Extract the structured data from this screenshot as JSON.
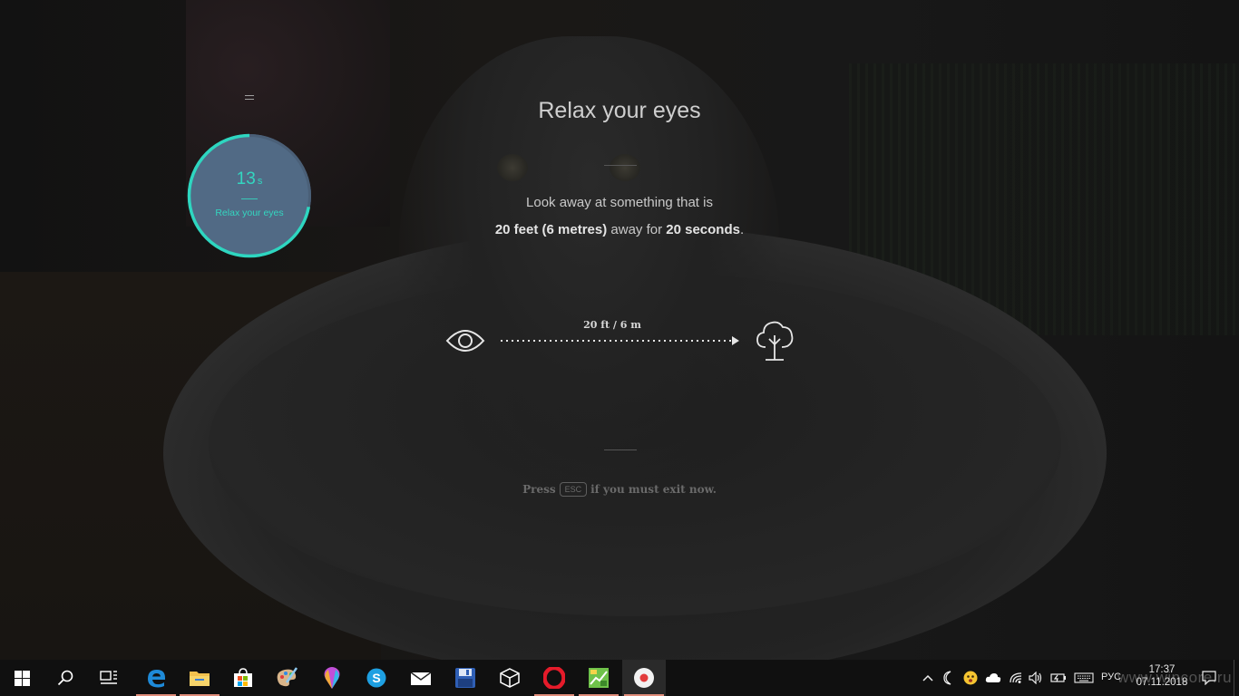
{
  "timer": {
    "seconds": "13",
    "unit": "s",
    "label": "Relax your eyes",
    "progress": 0.72,
    "accent": "#2ed6c0"
  },
  "main": {
    "title": "Relax your eyes",
    "line1": "Look away at something that is",
    "line2_bold1": "20 feet (6 metres)",
    "line2_text": " away for ",
    "line2_bold2": "20 seconds",
    "line2_end": ".",
    "distance_label": "20 ft  / 6 m",
    "press_prefix": "Press",
    "press_key": "ESC",
    "press_suffix": "if you must exit now."
  },
  "taskbar": {
    "apps": [
      {
        "name": "start",
        "icon": "windows-logo-icon"
      },
      {
        "name": "search",
        "icon": "search-icon"
      },
      {
        "name": "task-view",
        "icon": "task-view-icon"
      },
      {
        "name": "edge",
        "icon": "edge-icon",
        "running": true
      },
      {
        "name": "file-explorer",
        "icon": "folder-icon",
        "running": true
      },
      {
        "name": "store",
        "icon": "store-icon"
      },
      {
        "name": "paint",
        "icon": "paint-palette-icon"
      },
      {
        "name": "paint-3d",
        "icon": "paint-3d-icon"
      },
      {
        "name": "skype",
        "icon": "skype-icon"
      },
      {
        "name": "mail",
        "icon": "mail-icon"
      },
      {
        "name": "save-app",
        "icon": "floppy-disk-icon"
      },
      {
        "name": "3d-viewer",
        "icon": "cube-icon"
      },
      {
        "name": "opera",
        "icon": "opera-icon",
        "running": true
      },
      {
        "name": "maps-app",
        "icon": "map-app-icon",
        "running": true
      },
      {
        "name": "eye-break-app",
        "icon": "record-icon",
        "running": true,
        "active": true
      }
    ],
    "language": "РУС",
    "time": "17:37",
    "date": "07.11.2018",
    "watermark": "www.wincore.ru"
  }
}
